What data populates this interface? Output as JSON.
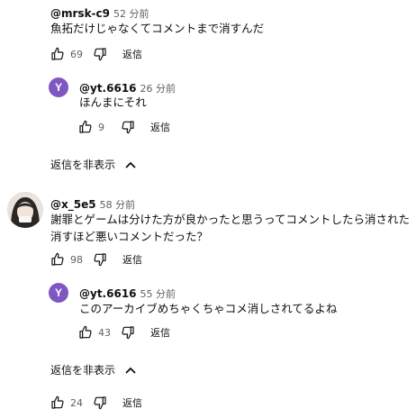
{
  "comments": [
    {
      "author": "@mrsk-c9",
      "time": "52 分前",
      "text": "魚拓だけじゃなくてコメントまで消すんだ",
      "likes": "69",
      "reply_label": "返信",
      "replies": [
        {
          "avatar_letter": "Y",
          "author": "@yt.6616",
          "time": "26 分前",
          "text": "ほんまにそれ",
          "likes": "9",
          "reply_label": "返信"
        }
      ],
      "hide_replies_label": "返信を非表示"
    },
    {
      "author": "@x_5e5",
      "time": "58 分前",
      "text_lines": [
        "謝罪とゲームは分けた方が良かったと思うってコメントしたら消された",
        "消すほど悪いコメントだった？"
      ],
      "likes": "98",
      "reply_label": "返信",
      "replies": [
        {
          "avatar_letter": "Y",
          "author": "@yt.6616",
          "time": "55 分前",
          "text": "このアーカイブめちゃくちゃコメ消しされてるよね",
          "likes": "43",
          "reply_label": "返信"
        }
      ],
      "hide_replies_label": "返信を非表示"
    },
    {
      "likes": "24",
      "reply_label": "返信"
    }
  ],
  "colors": {
    "text": "#0f0f0f",
    "secondary": "#606060",
    "avatar_purple": "#7e57c2"
  }
}
